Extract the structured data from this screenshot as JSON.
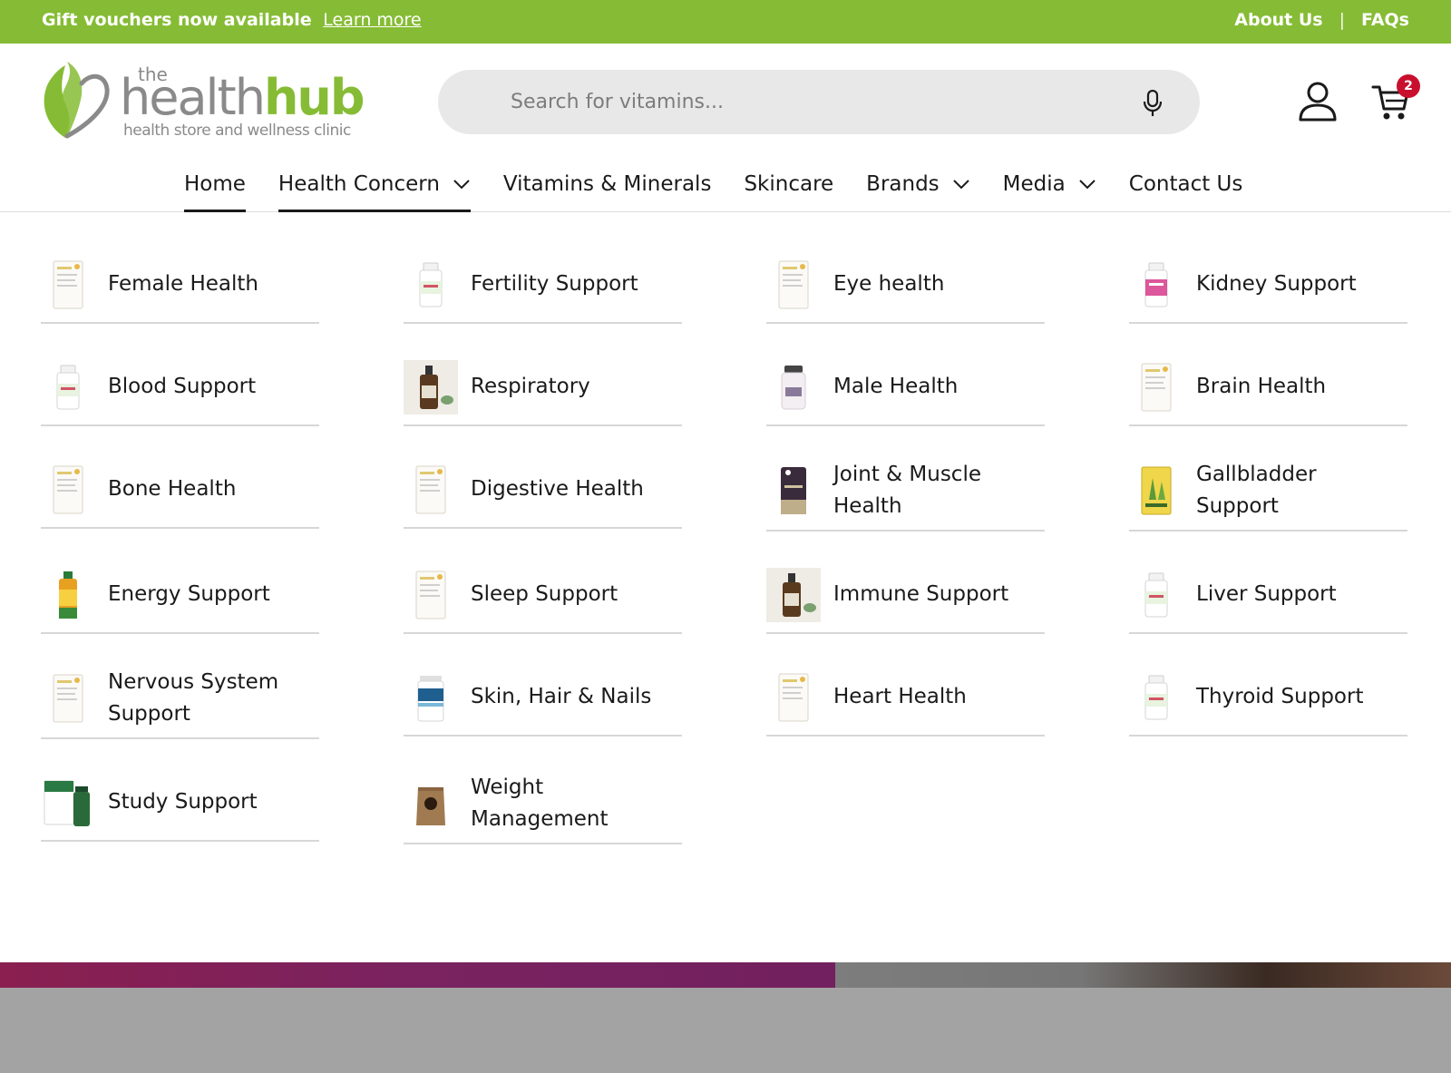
{
  "announcement": {
    "message": "Gift vouchers now available",
    "link": "Learn more",
    "about": "About Us",
    "separator": "|",
    "faqs": "FAQs",
    "bg_color": "#86bc35"
  },
  "logo": {
    "the": "the",
    "word_light": "health",
    "word_bold": "hub",
    "tagline": "health store and wellness clinic",
    "brand_green": "#86bc35",
    "brand_grey": "#8a8a8a"
  },
  "search": {
    "placeholder": "Search for vitamins...",
    "icon": "microphone-icon"
  },
  "header": {
    "account_icon": "user-icon",
    "cart_icon": "cart-icon",
    "cart_count": "2",
    "badge_color": "#c8102e"
  },
  "nav": {
    "items": [
      {
        "label": "Home",
        "active": true,
        "dropdown": false
      },
      {
        "label": "Health Concern",
        "active": true,
        "dropdown": true
      },
      {
        "label": "Vitamins & Minerals",
        "dropdown": false
      },
      {
        "label": "Skincare",
        "dropdown": false
      },
      {
        "label": "Brands",
        "dropdown": true
      },
      {
        "label": "Media",
        "dropdown": true
      },
      {
        "label": "Contact Us",
        "dropdown": false
      }
    ]
  },
  "menu": {
    "items": [
      {
        "label": "Female Health",
        "icon": "product-box-icon"
      },
      {
        "label": "Fertility Support",
        "icon": "supplement-bottle-icon"
      },
      {
        "label": "Eye health",
        "icon": "product-box-icon"
      },
      {
        "label": "Kidney Support",
        "icon": "probiotic-bottle-icon"
      },
      {
        "label": "Blood Support",
        "icon": "supplement-bottle-icon"
      },
      {
        "label": "Respiratory",
        "icon": "amber-bottle-icon"
      },
      {
        "label": "Male Health",
        "icon": "supplement-jar-icon"
      },
      {
        "label": "Brain Health",
        "icon": "product-box-icon"
      },
      {
        "label": "Bone Health",
        "icon": "product-box-icon"
      },
      {
        "label": "Digestive Health",
        "icon": "product-box-icon"
      },
      {
        "label": "Joint & Muscle Health",
        "icon": "dark-jar-icon"
      },
      {
        "label": "Gallbladder Support",
        "icon": "yellow-box-icon"
      },
      {
        "label": "Energy Support",
        "icon": "liquid-bottle-icon"
      },
      {
        "label": "Sleep Support",
        "icon": "product-box-icon"
      },
      {
        "label": "Immune Support",
        "icon": "amber-bottle-icon"
      },
      {
        "label": "Liver Support",
        "icon": "supplement-bottle-icon"
      },
      {
        "label": "Nervous System Support",
        "icon": "product-box-icon"
      },
      {
        "label": "Skin, Hair & Nails",
        "icon": "collagen-tub-icon"
      },
      {
        "label": "Heart Health",
        "icon": "product-box-icon"
      },
      {
        "label": "Thyroid Support",
        "icon": "supplement-bottle-icon"
      },
      {
        "label": "Study Support",
        "icon": "green-box-icon"
      },
      {
        "label": "Weight Management",
        "icon": "kraft-pouch-icon"
      }
    ]
  }
}
